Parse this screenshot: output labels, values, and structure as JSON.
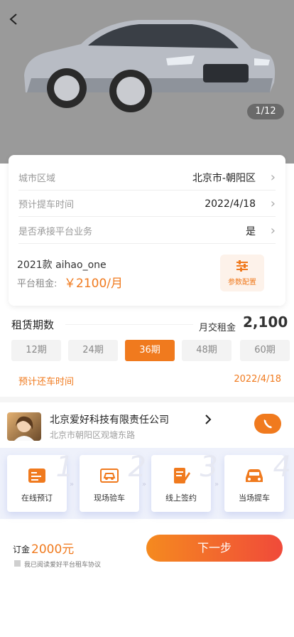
{
  "hero": {
    "counter": "1/12"
  },
  "info": {
    "rows": [
      {
        "label": "城市区域",
        "value": "北京市-朝阳区"
      },
      {
        "label": "预计提车时间",
        "value": "2022/4/18"
      },
      {
        "label": "是否承接平台业务",
        "value": "是"
      }
    ],
    "model": "2021款  aihao_one",
    "rent_label": "平台租金:",
    "rent_value": "￥2100/月",
    "config_button": "参数配置"
  },
  "lease": {
    "title": "租赁期数",
    "monthly_label": "月交租金",
    "monthly_value": "2,100",
    "periods": [
      "12期",
      "24期",
      "36期",
      "48期",
      "60期"
    ],
    "selected_period": "36期",
    "return_label": "预计还车时间",
    "return_value": "2022/4/18"
  },
  "company": {
    "name": "北京爱好科技有限责任公司",
    "address": "北京市朝阳区观塘东路"
  },
  "steps": [
    {
      "num": "1",
      "label": "在线预订",
      "icon": "order-form-icon"
    },
    {
      "num": "2",
      "label": "现场验车",
      "icon": "car-inspection-icon"
    },
    {
      "num": "3",
      "label": "线上签约",
      "icon": "sign-contract-icon"
    },
    {
      "num": "4",
      "label": "当场提车",
      "icon": "car-pickup-icon"
    }
  ],
  "footer": {
    "deposit_label": "订金",
    "deposit_value": "2000元",
    "agree_text": "我已阅读爱好平台租车协议",
    "next_button": "下一步"
  },
  "colors": {
    "accent": "#f07a1e",
    "gradient_end": "#f04a3a"
  }
}
